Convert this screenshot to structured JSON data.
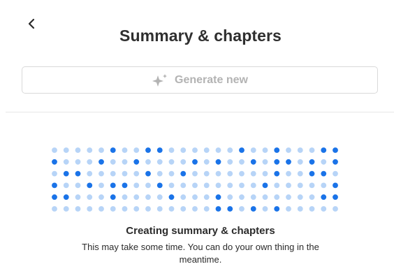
{
  "header": {
    "title": "Summary & chapters"
  },
  "actions": {
    "generate_label": "Generate new"
  },
  "status": {
    "title": "Creating summary & chapters",
    "message": "This may take some time. You can do your own thing in the meantime."
  },
  "icons": {
    "back": "chevron-left-icon",
    "generate": "sparkle-icon"
  },
  "colors": {
    "dot_active": "#1a73e8",
    "dot_inactive": "#b7d4f7",
    "title_text": "#2f2f2f",
    "disabled_text": "#b3b3b3",
    "button_border": "#d9d9d9",
    "divider": "#e6e6e6"
  },
  "loading_grid": {
    "rows": [
      "0000010011000000100100011",
      "1000100100001010010110101",
      "0110000010010000000100110",
      "1001011001000000001000001",
      "1100010000100010000000011",
      "0000000000000011010100000"
    ]
  }
}
